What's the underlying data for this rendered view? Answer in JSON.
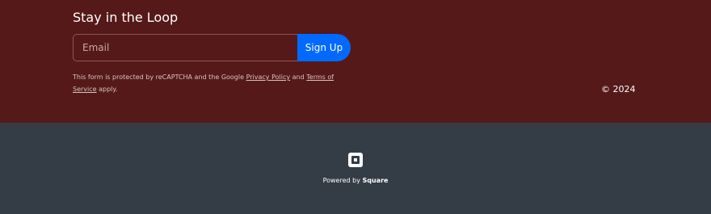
{
  "newsletter": {
    "title": "Stay in the Loop",
    "email_placeholder": "Email",
    "signup_label": "Sign Up",
    "notice_prefix": "This form is protected by reCAPTCHA and the Google",
    "privacy_policy_label": "Privacy Policy",
    "notice_and": "and",
    "terms_label": "Terms of Service",
    "notice_suffix": "apply."
  },
  "footer": {
    "copyright": "© 2024",
    "powered_by_prefix": "Powered by",
    "powered_by_brand": "Square",
    "logo_icon": "square-logo-icon"
  },
  "colors": {
    "footer_top_bg": "#561919",
    "footer_bottom_bg": "#343c46",
    "button_bg": "#006aff",
    "text": "#ffffff"
  }
}
